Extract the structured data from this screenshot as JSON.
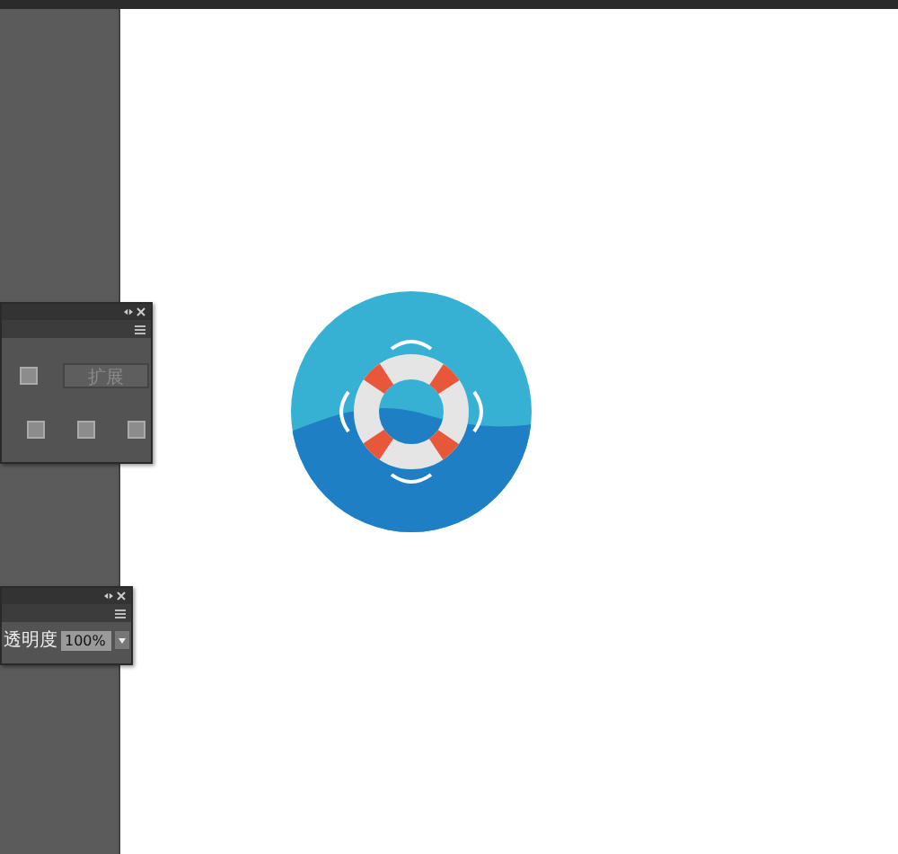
{
  "pathfinder_panel": {
    "expand_button": {
      "label": "扩展",
      "disabled": true
    }
  },
  "transparency_panel": {
    "opacity_label": "透明度",
    "opacity_value": "100%"
  },
  "artboard": {
    "artwork": {
      "kind": "lifebuoy-icon"
    }
  }
}
